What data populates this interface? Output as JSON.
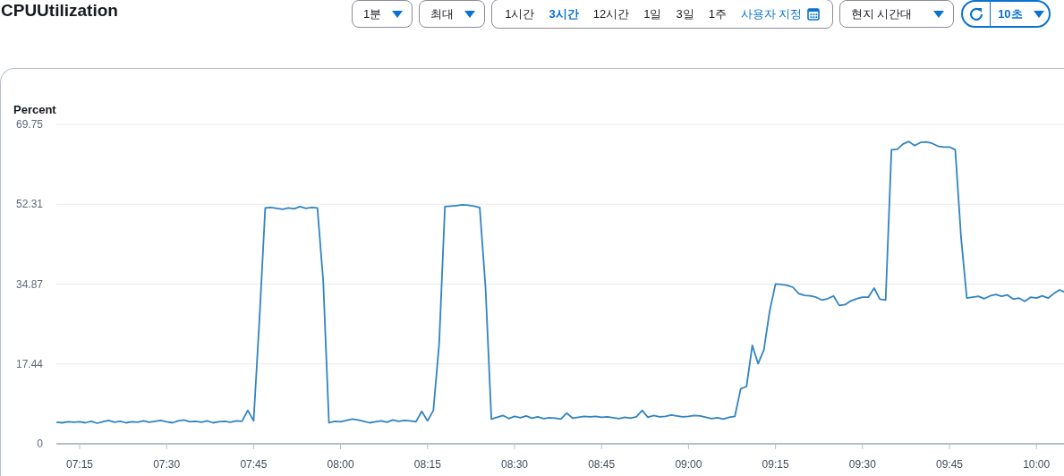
{
  "title": "CPUUtilization",
  "period": {
    "label": "1분"
  },
  "statistic": {
    "label": "최대"
  },
  "ranges": [
    {
      "label": "1시간",
      "selected": false,
      "kind": "preset"
    },
    {
      "label": "3시간",
      "selected": true,
      "kind": "preset"
    },
    {
      "label": "12시간",
      "selected": false,
      "kind": "preset"
    },
    {
      "label": "1일",
      "selected": false,
      "kind": "preset"
    },
    {
      "label": "3일",
      "selected": false,
      "kind": "preset"
    },
    {
      "label": "1주",
      "selected": false,
      "kind": "preset"
    },
    {
      "label": "사용자 지정",
      "selected": false,
      "kind": "custom"
    }
  ],
  "timezone": {
    "label": "현지 시간대"
  },
  "refresh": {
    "label": "10초"
  },
  "chart": {
    "chart_data": {
      "type": "line",
      "grid": true,
      "ylabel": "Percent",
      "ylim": [
        0,
        69.75
      ],
      "yticks": [
        69.75,
        52.31,
        34.87,
        17.44,
        0
      ],
      "categories": [
        null,
        null,
        null,
        null,
        "07:15",
        null,
        null,
        null,
        null,
        null,
        null,
        null,
        null,
        null,
        null,
        null,
        null,
        null,
        null,
        "07:30",
        null,
        null,
        null,
        null,
        null,
        null,
        null,
        null,
        null,
        null,
        null,
        null,
        null,
        null,
        "07:45",
        null,
        null,
        null,
        null,
        null,
        null,
        null,
        null,
        null,
        null,
        null,
        null,
        null,
        null,
        "08:00",
        null,
        null,
        null,
        null,
        null,
        null,
        null,
        null,
        null,
        null,
        null,
        null,
        null,
        null,
        "08:15",
        null,
        null,
        null,
        null,
        null,
        null,
        null,
        null,
        null,
        null,
        null,
        null,
        null,
        null,
        "08:30",
        null,
        null,
        null,
        null,
        null,
        null,
        null,
        null,
        null,
        null,
        null,
        null,
        null,
        null,
        "08:45",
        null,
        null,
        null,
        null,
        null,
        null,
        null,
        null,
        null,
        null,
        null,
        null,
        null,
        null,
        "09:00",
        null,
        null,
        null,
        null,
        null,
        null,
        null,
        null,
        null,
        null,
        null,
        null,
        null,
        null,
        "09:15",
        null,
        null,
        null,
        null,
        null,
        null,
        null,
        null,
        null,
        null,
        null,
        null,
        null,
        null,
        "09:30",
        null,
        null,
        null,
        null,
        null,
        null,
        null,
        null,
        null,
        null,
        null,
        null,
        null,
        null,
        "09:45",
        null,
        null,
        null,
        null,
        null,
        null,
        null,
        null,
        null,
        null,
        null,
        null,
        null,
        null,
        "10:00",
        null,
        null,
        null,
        null,
        null
      ],
      "series": [
        {
          "color": "#3184c2",
          "values": [
            4.7,
            4.6,
            4.8,
            4.7,
            4.8,
            4.6,
            4.9,
            4.5,
            4.8,
            5.1,
            4.7,
            4.9,
            4.6,
            4.8,
            4.7,
            5.0,
            4.7,
            4.9,
            5.1,
            4.8,
            4.6,
            5.0,
            5.2,
            4.8,
            4.9,
            4.7,
            5.0,
            4.6,
            4.8,
            4.9,
            4.7,
            5.0,
            4.9,
            7.3,
            5.0,
            27,
            51.5,
            51.6,
            51.4,
            51.2,
            51.5,
            51.3,
            51.8,
            51.4,
            51.6,
            51.5,
            35.5,
            4.6,
            4.9,
            4.8,
            5.1,
            5.4,
            5.2,
            4.9,
            4.6,
            4.8,
            5.0,
            4.7,
            5.2,
            4.9,
            5.1,
            5.0,
            4.8,
            7.1,
            5.0,
            7.3,
            22.0,
            51.8,
            51.9,
            52.0,
            52.2,
            52.1,
            51.9,
            51.6,
            34,
            5.4,
            5.8,
            6.2,
            5.5,
            6.0,
            5.7,
            6.1,
            5.6,
            5.9,
            5.5,
            5.7,
            5.6,
            5.4,
            6.7,
            5.6,
            5.8,
            6.0,
            5.9,
            6.0,
            5.8,
            5.9,
            5.7,
            5.5,
            5.8,
            5.6,
            5.9,
            7.3,
            5.8,
            6.2,
            5.9,
            6.0,
            6.3,
            6.1,
            5.9,
            6.0,
            6.2,
            6.1,
            5.8,
            5.5,
            5.7,
            5.4,
            5.8,
            6.0,
            12.0,
            12.5,
            21.5,
            17.5,
            20.5,
            29,
            34.9,
            34.8,
            34.6,
            34.2,
            32.8,
            32.4,
            32.3,
            32.0,
            31.4,
            31.7,
            32.3,
            30.2,
            30.4,
            31.2,
            31.7,
            32.0,
            32.0,
            34.0,
            31.6,
            31.4,
            64.2,
            64.3,
            65.5,
            66.0,
            65.1,
            65.8,
            65.9,
            65.6,
            65.0,
            64.8,
            64.8,
            64.2,
            45,
            31.8,
            32.0,
            32.2,
            31.7,
            32.3,
            32.6,
            32.2,
            32.5,
            31.6,
            31.8,
            31.1,
            32.0,
            31.8,
            32.3,
            31.8,
            32.8,
            33.6,
            33.0
          ]
        }
      ]
    }
  }
}
